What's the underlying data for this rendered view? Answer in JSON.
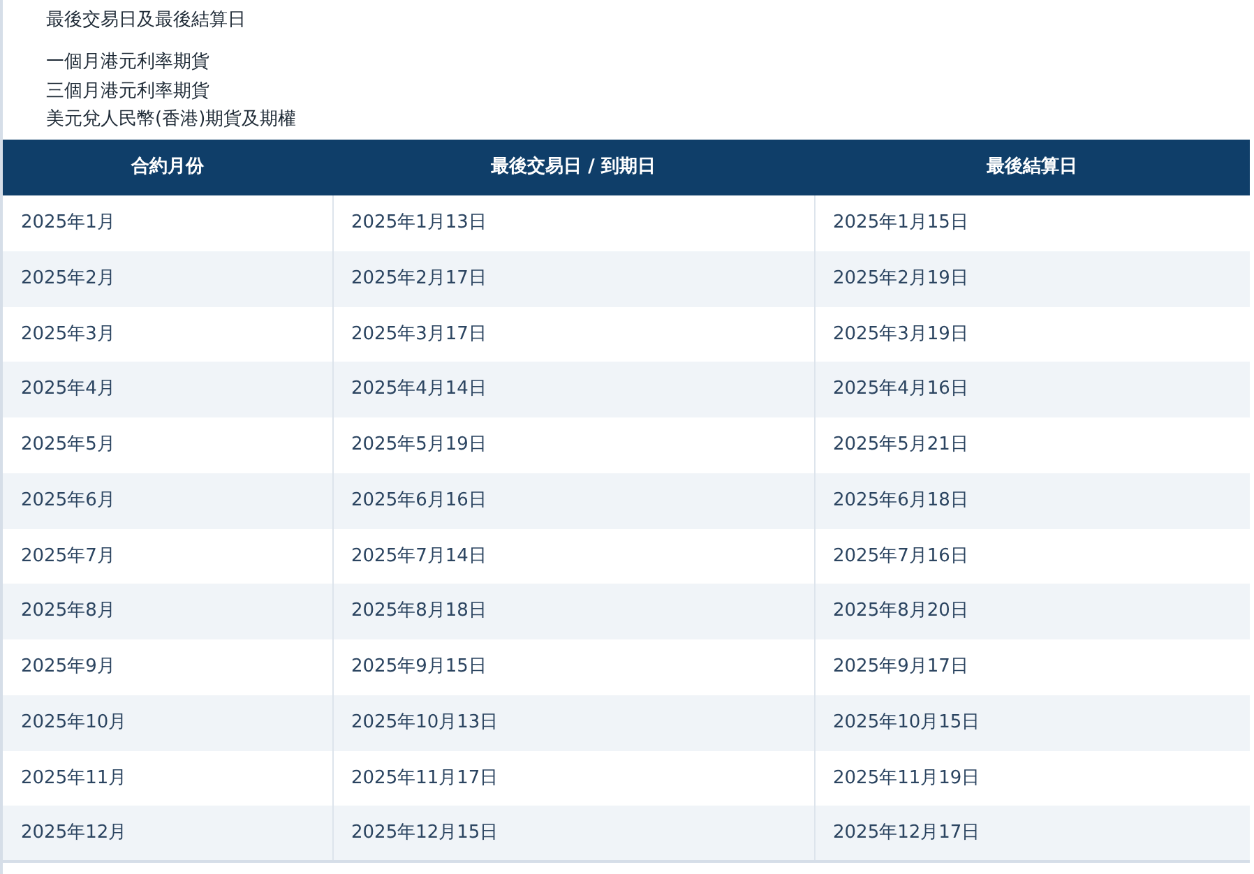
{
  "title": "最後交易日及最後結算日",
  "products": [
    "一個月港元利率期貨",
    "三個月港元利率期貨",
    "美元兌人民幣(香港)期貨及期權"
  ],
  "table": {
    "columns": [
      "合約月份",
      "最後交易日 / 到期日",
      "最後結算日"
    ],
    "rows": [
      [
        "2025年1月",
        "2025年1月13日",
        "2025年1月15日"
      ],
      [
        "2025年2月",
        "2025年2月17日",
        "2025年2月19日"
      ],
      [
        "2025年3月",
        "2025年3月17日",
        "2025年3月19日"
      ],
      [
        "2025年4月",
        "2025年4月14日",
        "2025年4月16日"
      ],
      [
        "2025年5月",
        "2025年5月19日",
        "2025年5月21日"
      ],
      [
        "2025年6月",
        "2025年6月16日",
        "2025年6月18日"
      ],
      [
        "2025年7月",
        "2025年7月14日",
        "2025年7月16日"
      ],
      [
        "2025年8月",
        "2025年8月18日",
        "2025年8月20日"
      ],
      [
        "2025年9月",
        "2025年9月15日",
        "2025年9月17日"
      ],
      [
        "2025年10月",
        "2025年10月13日",
        "2025年10月15日"
      ],
      [
        "2025年11月",
        "2025年11月17日",
        "2025年11月19日"
      ],
      [
        "2025年12月",
        "2025年12月15日",
        "2025年12月17日"
      ]
    ]
  }
}
